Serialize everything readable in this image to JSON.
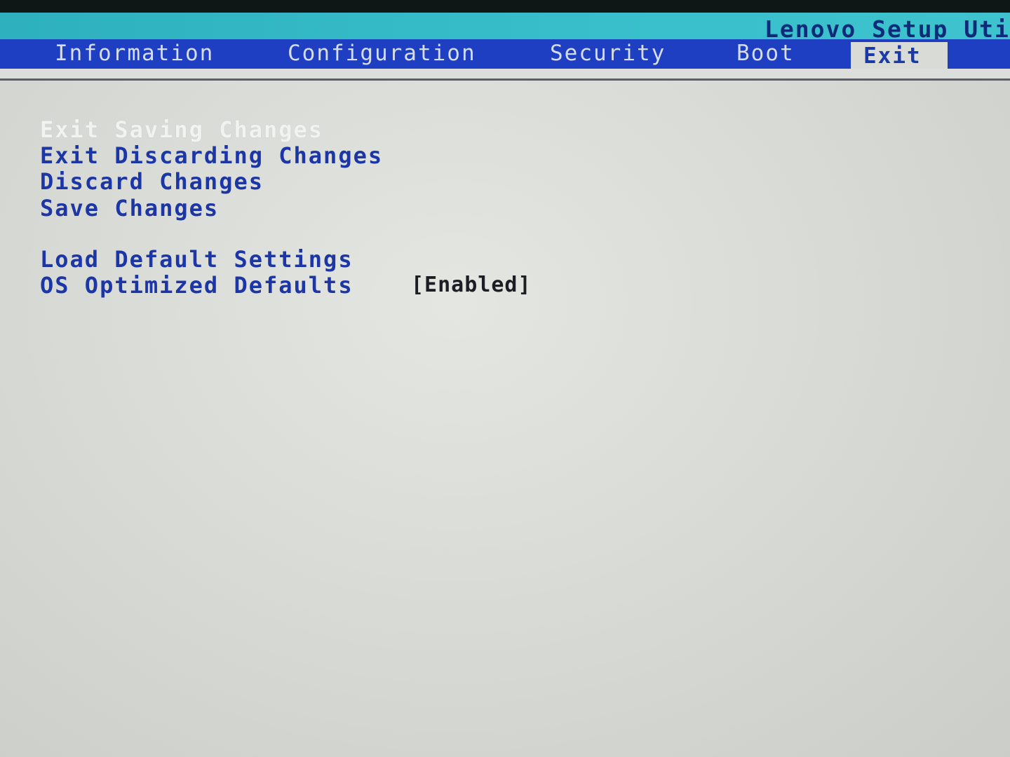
{
  "app": {
    "title": "Lenovo Setup Utili"
  },
  "tabs": [
    {
      "label": "Information",
      "active": false
    },
    {
      "label": "Configuration",
      "active": false
    },
    {
      "label": "Security",
      "active": false
    },
    {
      "label": "Boot",
      "active": false
    },
    {
      "label": "Exit",
      "active": true
    }
  ],
  "exit_menu": {
    "items": [
      {
        "label": "Exit Saving Changes",
        "selected": true
      },
      {
        "label": "Exit Discarding Changes",
        "selected": false
      },
      {
        "label": "Discard Changes",
        "selected": false
      },
      {
        "label": "Save Changes",
        "selected": false
      },
      {
        "label": "Load Default Settings",
        "selected": false
      },
      {
        "label": "OS Optimized Defaults",
        "selected": false,
        "value": "[Enabled]"
      }
    ]
  },
  "colors": {
    "title_strip": "#38bfcb",
    "menu_bar": "#1f3fc2",
    "menu_text": "#1d36a6",
    "selected_text": "#f2f3f1",
    "background": "#d9dbd7"
  }
}
